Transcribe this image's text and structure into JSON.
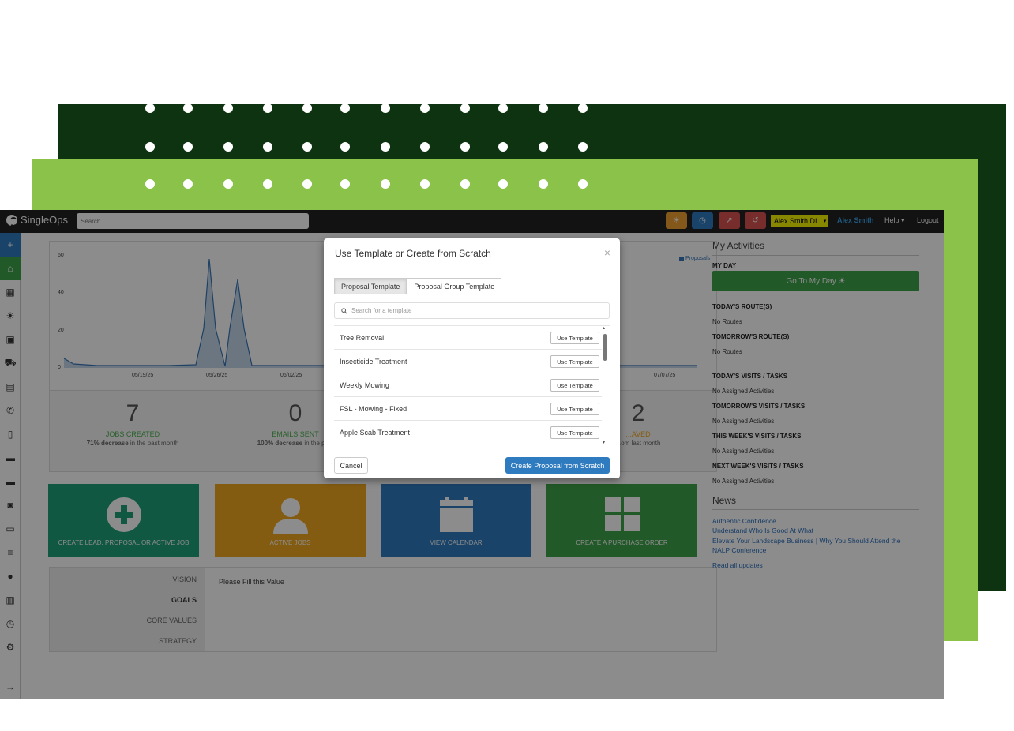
{
  "app": {
    "brand": "SingleOps",
    "search_placeholder": "Search"
  },
  "topbar": {
    "user_select": "Alex Smith DI",
    "user_name": "Alex Smith",
    "help": "Help",
    "logout": "Logout",
    "button_colors": [
      "#f0a030",
      "#2f7bbf",
      "#d9534f",
      "#d9534f"
    ]
  },
  "chart_data": {
    "type": "line",
    "legend": [
      "Proposals"
    ],
    "y_ticks": [
      "60",
      "40",
      "20",
      "0"
    ],
    "x_ticks": [
      "05/19/25",
      "05/26/25",
      "06/02/25",
      "07/07/25"
    ],
    "ylim": [
      0,
      60
    ]
  },
  "stats": [
    {
      "num": "7",
      "label": "JOBS CREATED",
      "sub_bold": "71% decrease",
      "sub": " in the past month"
    },
    {
      "num": "0",
      "label": "EMAILS SENT",
      "sub_bold": "100% decrease",
      "sub": " in the past"
    },
    {
      "num": "2",
      "label": "...AVED",
      "sub_bold": "",
      "sub": "...om last month"
    }
  ],
  "tiles": [
    {
      "label": "CREATE LEAD, PROPOSAL OR ACTIVE JOB",
      "color": "#1fa07a"
    },
    {
      "label": "ACTIVE JOBS",
      "color": "#f0a820"
    },
    {
      "label": "VIEW CALENDAR",
      "color": "#2f7bbf"
    },
    {
      "label": "CREATE A PURCHASE ORDER",
      "color": "#3ea34a"
    }
  ],
  "vmv": {
    "items": [
      "VISION",
      "GOALS",
      "CORE VALUES",
      "STRATEGY"
    ],
    "content": "Please Fill this Value"
  },
  "activities": {
    "title": "My Activities",
    "my_day": "MY DAY",
    "my_day_button": "Go To My Day ☀",
    "todays_routes": "TODAY'S ROUTE(S)",
    "no_routes": "No Routes",
    "tomorrows_routes": "TOMORROW'S ROUTE(S)",
    "no_routes_2": "No Routes",
    "todays_visits": "TODAY'S VISITS / TASKS",
    "no_assigned_1": "No Assigned Activities",
    "tomorrows_visits": "TOMORROW'S VISITS / TASKS",
    "no_assigned_2": "No Assigned Activities",
    "this_week": "THIS WEEK'S VISITS / TASKS",
    "no_assigned_3": "No Assigned Activities",
    "next_week": "NEXT WEEK'S VISITS / TASKS",
    "no_assigned_4": "No Assigned Activities",
    "news_title": "News",
    "news": [
      "Authentic Confidence",
      "Understand Who Is Good At What",
      "Elevate Your Landscape Business | Why You Should Attend the NALP Conference"
    ],
    "read_all": "Read all updates"
  },
  "modal": {
    "title": "Use Template or Create from Scratch",
    "close": "×",
    "tabs": [
      "Proposal Template",
      "Proposal Group Template"
    ],
    "search_placeholder": "Search for a template",
    "templates": [
      "Tree Removal",
      "Insecticide Treatment",
      "Weekly Mowing",
      "FSL - Mowing - Fixed",
      "Apple Scab Treatment"
    ],
    "use_label": "Use Template",
    "cancel": "Cancel",
    "create": "Create Proposal from Scratch"
  }
}
